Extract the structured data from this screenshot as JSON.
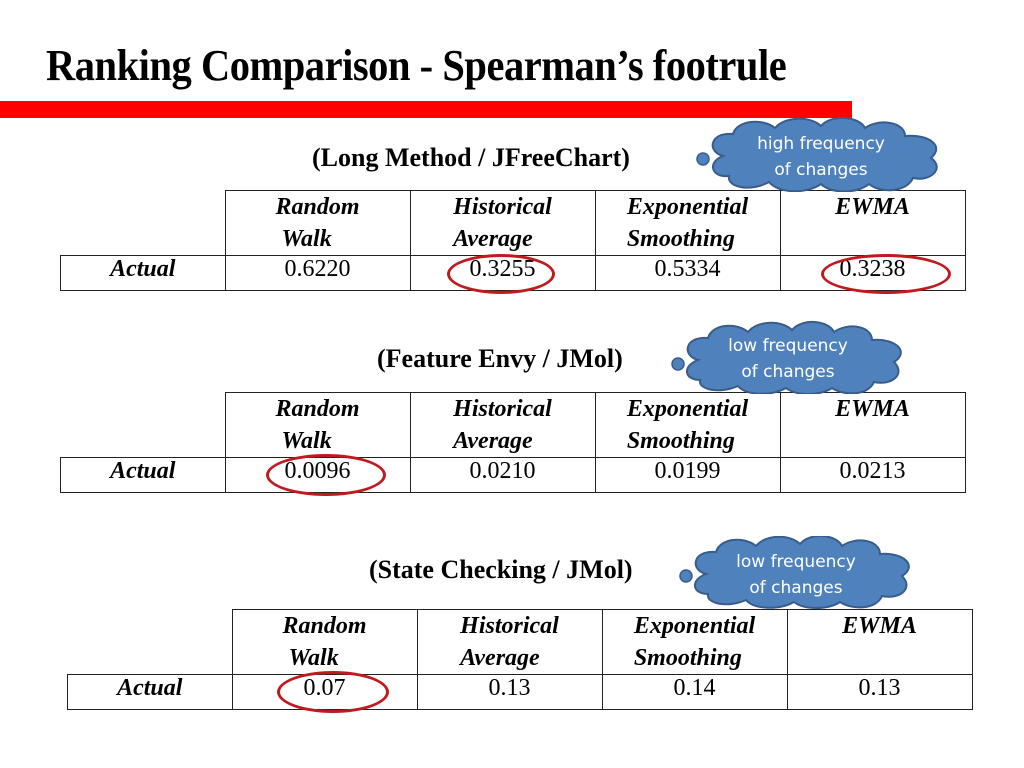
{
  "title": "Ranking Comparison - Spearman’s footrule",
  "accent_color": "#ff0000",
  "highlight_color": "#c0191e",
  "callout_color": "#4f81bd",
  "columns": [
    "Random Walk",
    "Historical Average",
    "Exponential Smoothing",
    "EWMA"
  ],
  "column_lines": [
    [
      "Random",
      "Walk"
    ],
    [
      "Historical",
      "Average"
    ],
    [
      "Exponential",
      "Smoothing"
    ],
    [
      "EWMA",
      ""
    ]
  ],
  "tables": [
    {
      "caption": "(Long Method / JFreeChart)",
      "callout": {
        "line1": "high frequency",
        "line2": "of changes"
      },
      "row_label": "Actual",
      "values": [
        "0.6220",
        "0.3255",
        "0.5334",
        "0.3238"
      ],
      "circled": [
        false,
        true,
        false,
        true
      ]
    },
    {
      "caption": "(Feature Envy / JMol)",
      "callout": {
        "line1": "low frequency",
        "line2": "of changes"
      },
      "row_label": "Actual",
      "values": [
        "0.0096",
        "0.0210",
        "0.0199",
        "0.0213"
      ],
      "circled": [
        true,
        false,
        false,
        false
      ]
    },
    {
      "caption": "(State Checking / JMol)",
      "callout": {
        "line1": "low frequency",
        "line2": "of changes"
      },
      "row_label": "Actual",
      "values": [
        "0.07",
        "0.13",
        "0.14",
        "0.13"
      ],
      "circled": [
        true,
        false,
        false,
        false
      ]
    }
  ]
}
